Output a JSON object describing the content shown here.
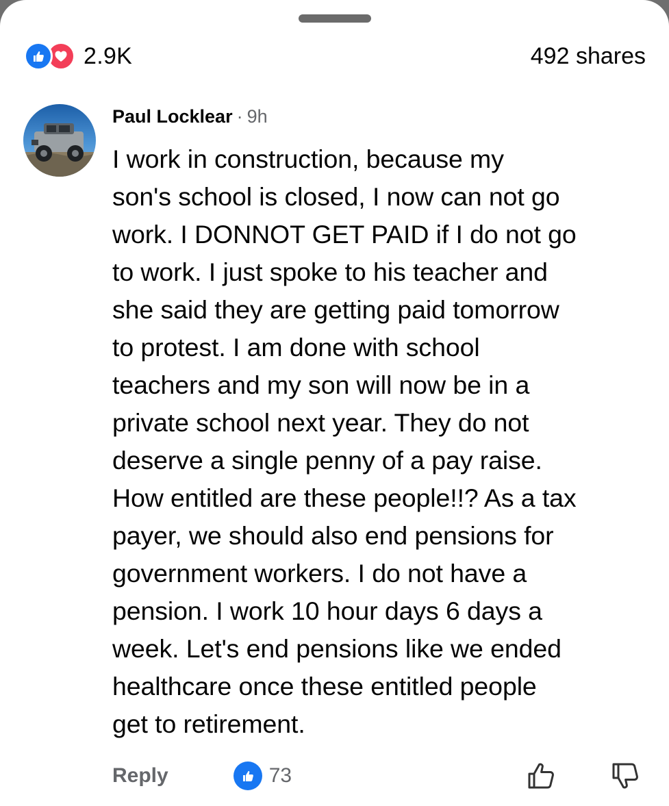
{
  "header": {
    "reaction_count": "2.9K",
    "shares": "492 shares",
    "reaction_icons": [
      "like-icon",
      "love-icon"
    ],
    "colors": {
      "like": "#1877f2",
      "love": "#f33e58"
    }
  },
  "comment": {
    "author": "Paul Locklear",
    "separator": "·",
    "time": "9h",
    "avatar": "avatar",
    "lines": [
      "I work in construction,  because my",
      "son's school is closed, I now can not go",
      "work.  I DONNOT GET PAID if I do not go",
      "to work.  I just spoke to his teacher and",
      "she said they are getting paid tomorrow",
      "to protest.  I am done with school",
      "teachers and my son will now be in a",
      "private school next year.  They do not",
      "deserve a single penny of a pay raise.",
      "How entitled are these people!!? As a tax",
      "payer, we should also end pensions for",
      "government workers.  I do not have a",
      "pension.  I work 10 hour days 6 days a",
      "week.  Let's end pensions like we ended",
      "healthcare once these entitled people",
      "get to retirement."
    ]
  },
  "actions": {
    "reply_label": "Reply",
    "like_count": "73",
    "upvote_icon": "thumbs-up-outline-icon",
    "downvote_icon": "thumbs-down-outline-icon",
    "secondary_text_color": "#65676b"
  }
}
